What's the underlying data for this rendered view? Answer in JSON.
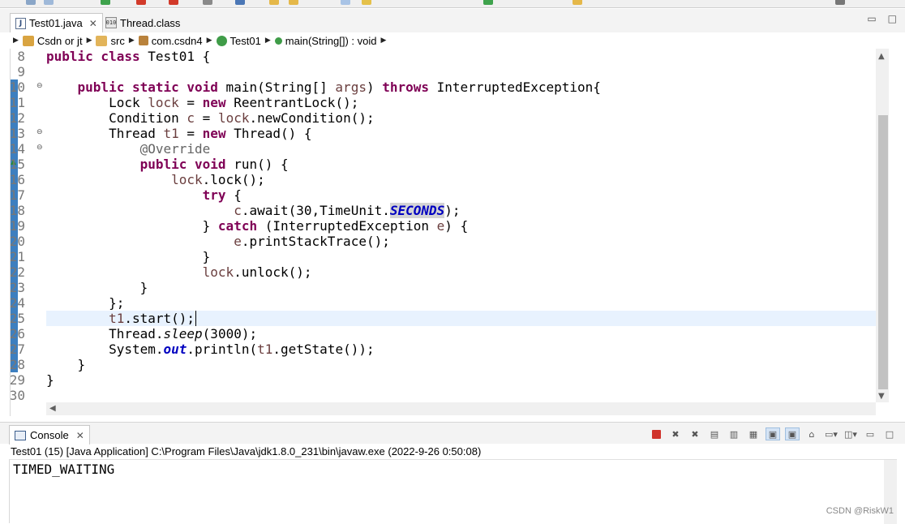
{
  "colors": {
    "keyword": "#7f0055",
    "local_var": "#6a3e3e",
    "annotation": "#646464",
    "field": "#0000c0",
    "current_line": "#e8f2fe",
    "change_bar": "#3d7fbf"
  },
  "editor_tabs": [
    {
      "label": "Test01.java",
      "icon": "java-file-icon",
      "active": true
    },
    {
      "label": "Thread.class",
      "icon": "class-file-icon",
      "active": false
    }
  ],
  "breadcrumb": [
    {
      "label": "Csdn or jt",
      "icon": "project-icon"
    },
    {
      "label": "src",
      "icon": "source-folder-icon"
    },
    {
      "label": "com.csdn4",
      "icon": "package-icon"
    },
    {
      "label": "Test01",
      "icon": "class-icon"
    },
    {
      "label": "main(String[]) : void",
      "icon": "static-method-icon"
    }
  ],
  "code": {
    "line_numbers": [
      "8",
      "9",
      "10",
      "11",
      "12",
      "13",
      "14",
      "15",
      "16",
      "17",
      "18",
      "19",
      "20",
      "21",
      "22",
      "23",
      "24",
      "25",
      "26",
      "27",
      "28",
      "29",
      "30"
    ],
    "current_line": "25",
    "lines": {
      "l8": {
        "kw": "public class",
        "rest": " Test01 {"
      },
      "l10": {
        "kw1": "public static void",
        "mid": " main(String[] ",
        "arg": "args",
        "mid2": ") ",
        "kw2": "throws",
        "rest": " InterruptedException{"
      },
      "l11": {
        "type": "Lock ",
        "var": "lock",
        "mid": " = ",
        "kw": "new",
        "rest": " ReentrantLock();"
      },
      "l12": {
        "type": "Condition ",
        "var": "c",
        "mid": " = ",
        "var2": "lock",
        "rest": ".newCondition();"
      },
      "l13": {
        "type": "Thread ",
        "var": "t1",
        "mid": " = ",
        "kw": "new",
        "rest": " Thread() {"
      },
      "l14": {
        "ann": "@Override"
      },
      "l15": {
        "kw": "public void",
        "rest": " run() {"
      },
      "l16": {
        "var": "lock",
        "rest": ".lock();"
      },
      "l17": {
        "kw": "try",
        "rest": " {"
      },
      "l18": {
        "var": "c",
        "mid": ".await(30,TimeUnit.",
        "field": "SECONDS",
        "rest": ");"
      },
      "l19": {
        "pre": "} ",
        "kw": "catch",
        "mid": " (InterruptedException ",
        "var": "e",
        "rest": ") {"
      },
      "l20": {
        "var": "e",
        "rest": ".printStackTrace();"
      },
      "l21": {
        "rest": "}"
      },
      "l22": {
        "var": "lock",
        "rest": ".unlock();"
      },
      "l23": {
        "rest": "}"
      },
      "l24": {
        "rest": "};"
      },
      "l25": {
        "var": "t1",
        "rest": ".start();"
      },
      "l26": {
        "pre": "Thread.",
        "smeth": "sleep",
        "rest": "(3000);"
      },
      "l27": {
        "pre": "System.",
        "field": "out",
        "mid": ".println(",
        "var": "t1",
        "rest": ".getState());"
      },
      "l28": {
        "rest": "}"
      },
      "l29": {
        "rest": "}"
      }
    }
  },
  "console": {
    "tab_label": "Console",
    "process": "Test01 (15) [Java Application] C:\\Program Files\\Java\\jdk1.8.0_231\\bin\\javaw.exe  (2022-9-26 0:50:08)",
    "output": "TIMED_WAITING"
  },
  "watermark": "CSDN @RiskW1"
}
